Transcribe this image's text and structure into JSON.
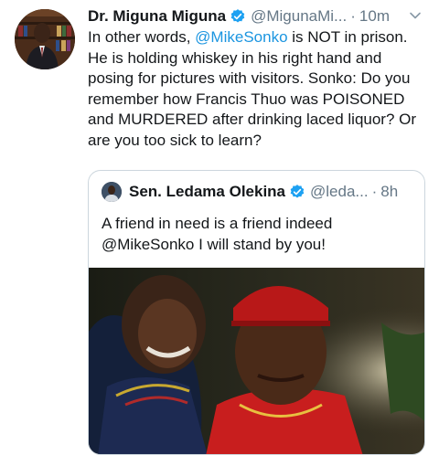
{
  "tweet": {
    "author_name": "Dr. Miguna Miguna",
    "author_handle": "@MigunaMi...",
    "separator": "·",
    "time": "10m",
    "text_parts": {
      "p1": "In other words, ",
      "mention": "@MikeSonko",
      "p2": " is NOT in prison. He is holding whiskey in his right hand and posing for pictures with visitors. Sonko: Do you remember how Francis Thuo was POISONED and MURDERED after drinking laced liquor? Or are you too sick to learn?"
    },
    "icons": {
      "verified": "verified-badge-icon",
      "menu": "chevron-down-icon"
    }
  },
  "quoted_tweet": {
    "author_name": "Sen. Ledama Olekina",
    "author_handle": "@leda...",
    "separator": "·",
    "time": "8h",
    "text": "A friend in need is a friend indeed @MikeSonko I will stand by you!"
  },
  "colors": {
    "text": "#14171a",
    "secondary": "#657786",
    "link": "#1b95e0",
    "verified": "#1da1f2",
    "border": "#ccd6dd"
  }
}
